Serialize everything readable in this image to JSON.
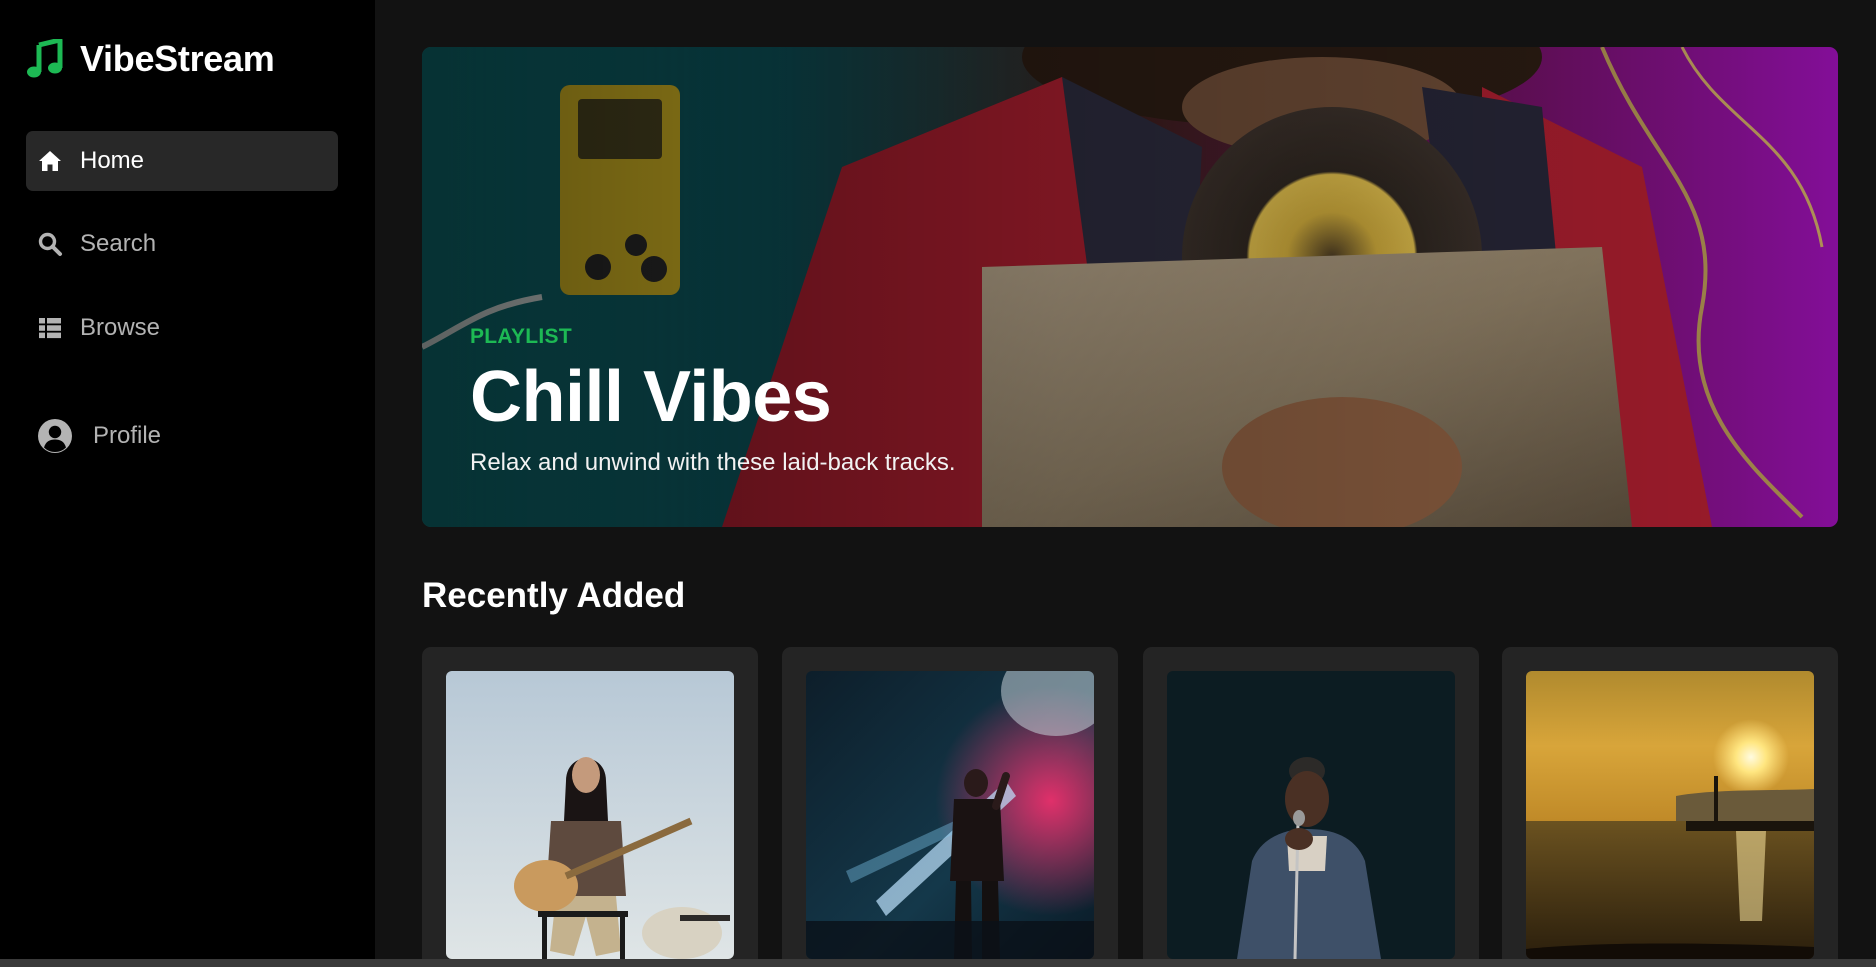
{
  "brand": {
    "name": "VibeStream",
    "icon": "music-note-icon",
    "accent_color": "#1db954"
  },
  "sidebar": {
    "items": [
      {
        "label": "Home",
        "icon": "home-icon",
        "active": true
      },
      {
        "label": "Search",
        "icon": "search-icon",
        "active": false
      },
      {
        "label": "Browse",
        "icon": "list-icon",
        "active": false
      },
      {
        "label": "Profile",
        "icon": "user-circle-icon",
        "active": false
      }
    ]
  },
  "hero": {
    "eyebrow": "PLAYLIST",
    "title": "Chill Vibes",
    "description": "Relax and unwind with these laid-back tracks."
  },
  "recently_added": {
    "title": "Recently Added",
    "cards": [
      {
        "image": "girl-with-guitar-photo"
      },
      {
        "image": "concert-singer-photo"
      },
      {
        "image": "singer-with-microphone-photo"
      },
      {
        "image": "sunset-pier-photo"
      }
    ]
  }
}
